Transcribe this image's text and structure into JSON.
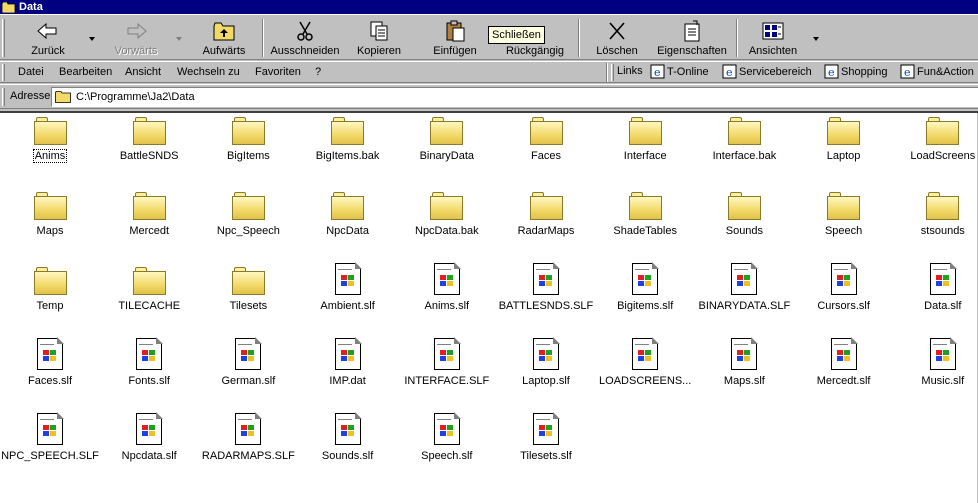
{
  "window": {
    "title": "Data"
  },
  "toolbar": {
    "back_label": "Zurück",
    "forward_label": "Vorwärts",
    "up_label": "Aufwärts",
    "cut_label": "Ausschneiden",
    "copy_label": "Kopieren",
    "paste_label": "Einfügen",
    "undo_label": "Rückgängig",
    "delete_label": "Löschen",
    "properties_label": "Eigenschaften",
    "views_label": "Ansichten",
    "tooltip": "Schließen"
  },
  "menubar": {
    "items": [
      "Datei",
      "Bearbeiten",
      "Ansicht",
      "Wechseln zu",
      "Favoriten",
      "?"
    ],
    "links_label": "Links",
    "links": [
      "T-Online",
      "Servicebereich",
      "Shopping",
      "Fun&Action"
    ]
  },
  "address": {
    "label": "Adresse",
    "value": "C:\\Programme\\Ja2\\Data"
  },
  "files": [
    {
      "name": "Anims",
      "type": "folder"
    },
    {
      "name": "BattleSNDS",
      "type": "folder"
    },
    {
      "name": "BigItems",
      "type": "folder"
    },
    {
      "name": "BigItems.bak",
      "type": "folder"
    },
    {
      "name": "BinaryData",
      "type": "folder"
    },
    {
      "name": "Faces",
      "type": "folder"
    },
    {
      "name": "Interface",
      "type": "folder"
    },
    {
      "name": "Interface.bak",
      "type": "folder"
    },
    {
      "name": "Laptop",
      "type": "folder"
    },
    {
      "name": "LoadScreens",
      "type": "folder"
    },
    {
      "name": "Maps",
      "type": "folder"
    },
    {
      "name": "Mercedt",
      "type": "folder"
    },
    {
      "name": "Npc_Speech",
      "type": "folder"
    },
    {
      "name": "NpcData",
      "type": "folder"
    },
    {
      "name": "NpcData.bak",
      "type": "folder"
    },
    {
      "name": "RadarMaps",
      "type": "folder"
    },
    {
      "name": "ShadeTables",
      "type": "folder"
    },
    {
      "name": "Sounds",
      "type": "folder"
    },
    {
      "name": "Speech",
      "type": "folder"
    },
    {
      "name": "stsounds",
      "type": "folder"
    },
    {
      "name": "Temp",
      "type": "folder"
    },
    {
      "name": "TILECACHE",
      "type": "folder"
    },
    {
      "name": "Tilesets",
      "type": "folder"
    },
    {
      "name": "Ambient.slf",
      "type": "file"
    },
    {
      "name": "Anims.slf",
      "type": "file"
    },
    {
      "name": "BATTLESNDS.SLF",
      "type": "file"
    },
    {
      "name": "Bigitems.slf",
      "type": "file"
    },
    {
      "name": "BINARYDATA.SLF",
      "type": "file"
    },
    {
      "name": "Cursors.slf",
      "type": "file"
    },
    {
      "name": "Data.slf",
      "type": "file"
    },
    {
      "name": "Faces.slf",
      "type": "file"
    },
    {
      "name": "Fonts.slf",
      "type": "file"
    },
    {
      "name": "German.slf",
      "type": "file"
    },
    {
      "name": "IMP.dat",
      "type": "file"
    },
    {
      "name": "INTERFACE.SLF",
      "type": "file"
    },
    {
      "name": "Laptop.slf",
      "type": "file"
    },
    {
      "name": "LOADSCREENS...",
      "type": "file"
    },
    {
      "name": "Maps.slf",
      "type": "file"
    },
    {
      "name": "Mercedt.slf",
      "type": "file"
    },
    {
      "name": "Music.slf",
      "type": "file"
    },
    {
      "name": "NPC_SPEECH.SLF",
      "type": "file"
    },
    {
      "name": "Npcdata.slf",
      "type": "file"
    },
    {
      "name": "RADARMAPS.SLF",
      "type": "file"
    },
    {
      "name": "Sounds.slf",
      "type": "file"
    },
    {
      "name": "Speech.slf",
      "type": "file"
    },
    {
      "name": "Tilesets.slf",
      "type": "file"
    }
  ]
}
